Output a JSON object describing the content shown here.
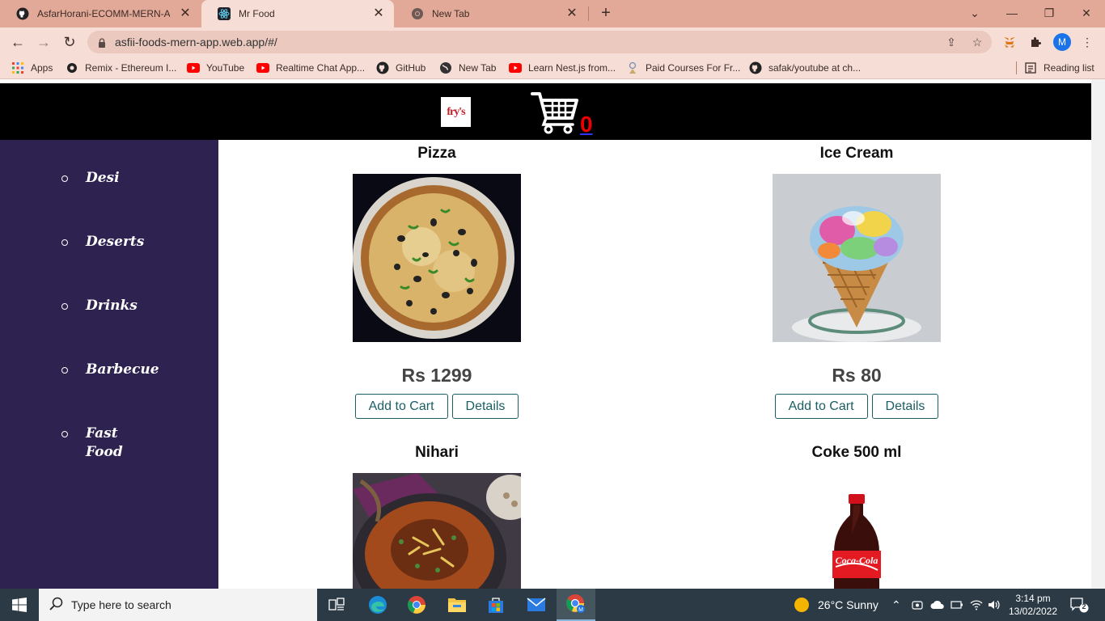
{
  "browser": {
    "tabs": [
      {
        "title": "AsfarHorani-ECOMM-MERN-APP",
        "icon": "github-icon",
        "active": false
      },
      {
        "title": "Mr Food",
        "icon": "react-icon",
        "active": true
      },
      {
        "title": "New Tab",
        "icon": "chrome-icon",
        "active": false
      }
    ],
    "url": "asfii-foods-mern-app.web.app/#/",
    "profile_initial": "M",
    "bookmarks": [
      {
        "label": "Apps",
        "icon": "apps-grid-icon"
      },
      {
        "label": "Remix - Ethereum I...",
        "icon": "remix-icon"
      },
      {
        "label": "YouTube",
        "icon": "youtube-icon"
      },
      {
        "label": "Realtime Chat App...",
        "icon": "youtube-icon"
      },
      {
        "label": "GitHub",
        "icon": "github-icon"
      },
      {
        "label": "New Tab",
        "icon": "globe-icon"
      },
      {
        "label": "Learn Nest.js from...",
        "icon": "youtube-icon"
      },
      {
        "label": "Paid Courses For Fr...",
        "icon": "course-icon"
      },
      {
        "label": "safak/youtube at ch...",
        "icon": "github-icon"
      }
    ],
    "reading_list": "Reading list"
  },
  "site": {
    "logo_text": "fry's",
    "cart_count": "0",
    "categories": [
      "Desi",
      "Deserts",
      "Drinks",
      "Barbecue",
      "Fast Food"
    ],
    "products": [
      {
        "name": "Pizza",
        "price": "Rs 1299",
        "add_label": "Add to Cart",
        "details_label": "Details"
      },
      {
        "name": "Ice Cream",
        "price": "Rs 80",
        "add_label": "Add to Cart",
        "details_label": "Details"
      },
      {
        "name": "Nihari"
      },
      {
        "name": "Coke 500 ml"
      }
    ],
    "coke_label": "Coca-Cola"
  },
  "taskbar": {
    "search_placeholder": "Type here to search",
    "weather": "26°C  Sunny",
    "time": "3:14 pm",
    "date": "13/02/2022",
    "notifications": "2"
  },
  "colors": {
    "tabbar": "#e3a998",
    "sidebar": "#2e2250",
    "button_border": "#1b5e63",
    "cart_count": "#e00000"
  }
}
